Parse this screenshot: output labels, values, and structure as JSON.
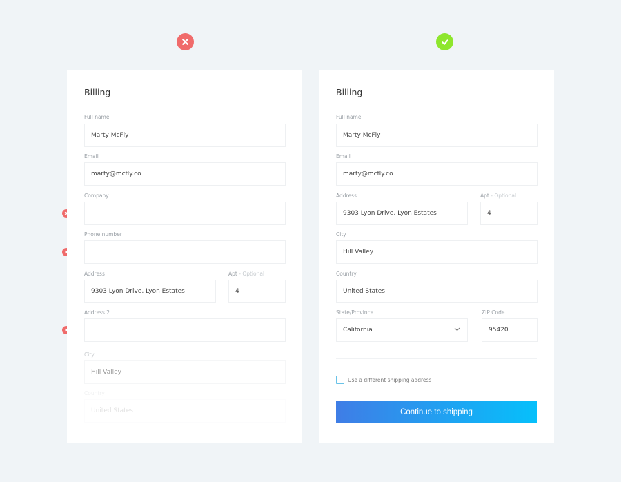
{
  "colors": {
    "bad": "#f06b6b",
    "good": "#8ee62d",
    "accent_start": "#3f7de6",
    "accent_end": "#06c0fb"
  },
  "bad_example": {
    "title": "Billing",
    "fields": [
      {
        "label": "Full name",
        "value": "Marty McFly"
      },
      {
        "label": "Email",
        "value": "marty@mcfly.co"
      },
      {
        "label": "Company",
        "value": ""
      },
      {
        "label": "Phone number",
        "value": ""
      },
      {
        "label": "Address",
        "value": "9303 Lyon Drive, Lyon Estates"
      },
      {
        "label": "Apt",
        "optional": "- Optional",
        "value": "4"
      },
      {
        "label": "Address 2",
        "value": ""
      },
      {
        "label": "City",
        "value": "Hill Valley"
      },
      {
        "label": "Country",
        "value": "United States"
      }
    ]
  },
  "good_example": {
    "title": "Billing",
    "fields": [
      {
        "label": "Full name",
        "value": "Marty McFly"
      },
      {
        "label": "Email",
        "value": "marty@mcfly.co"
      },
      {
        "label": "Address",
        "value": "9303 Lyon Drive, Lyon Estates"
      },
      {
        "label": "Apt",
        "optional": "- Optional",
        "value": "4"
      },
      {
        "label": "City",
        "value": "Hill Valley"
      },
      {
        "label": "Country",
        "value": "United States"
      },
      {
        "label": "State/Province",
        "value": "California"
      },
      {
        "label": "ZIP Code",
        "value": "95420"
      }
    ],
    "checkbox_label": "Use a different shipping address",
    "checkbox_checked": false,
    "button_label": "Continue to shipping"
  }
}
